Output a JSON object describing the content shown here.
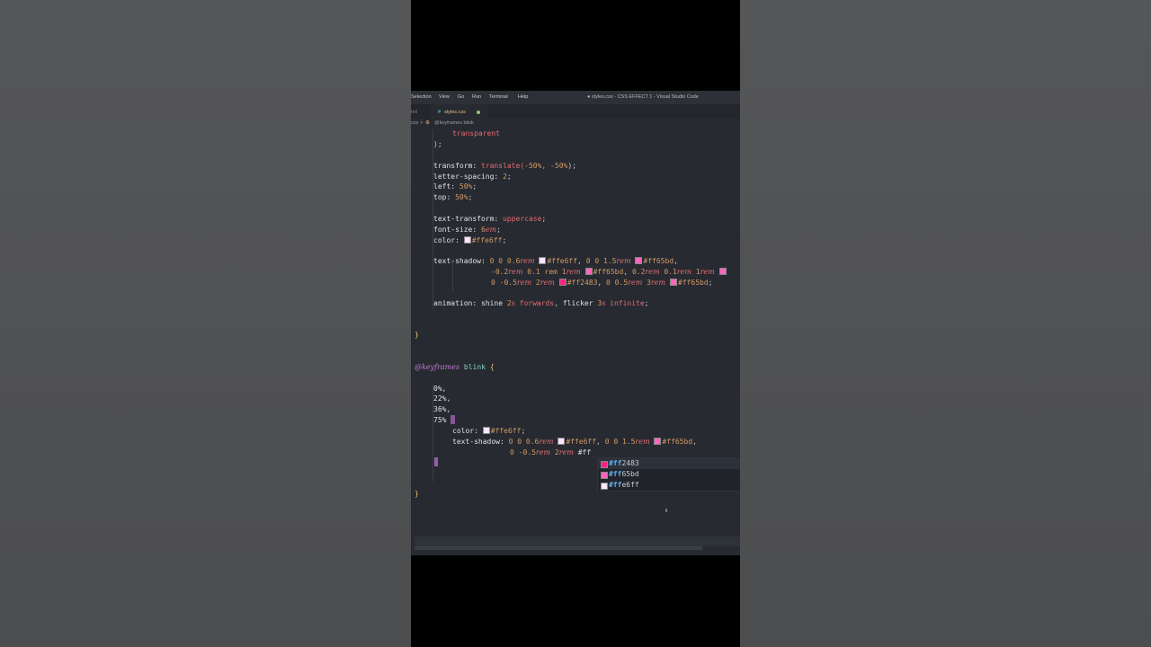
{
  "window": {
    "title": "● styles.css - CSS EFFECT 1 - Visual Studio Code",
    "menu": [
      "Selection",
      "View",
      "Go",
      "Run",
      "Terminal",
      "Help"
    ]
  },
  "tabs": {
    "previous": "tml",
    "active_icon": "#",
    "active": "styles.css"
  },
  "breadcrumb": {
    "file": "css",
    "sep": ">",
    "symbol": "@keyframes blink"
  },
  "colors": {
    "ffe6ff": "#ffe6ff",
    "ff65bd": "#ff65bd",
    "ff2483": "#ff2483",
    "accent": "#c678dd"
  },
  "code": {
    "l1": "transparent",
    "l2": ");",
    "transform_prop": "transform: ",
    "transform_val": "translate(",
    "transform_args": "-50%, -50%",
    "transform_end": ");",
    "ls_prop": "letter-spacing: ",
    "ls_val": "2",
    "left_prop": "left: ",
    "left_val": "50%",
    "top_prop": "top: ",
    "top_val": "50%",
    "tt_prop": "text-transform: ",
    "tt_val": "uppercase",
    "fs_prop": "font-size: ",
    "fs_val": "6",
    "fs_unit": "em",
    "color_prop": "color: ",
    "ffe6ff": "#ffe6ff",
    "ff65bd": "#ff65bd",
    "ff2483": "#ff2483",
    "ts_prop": "text-shadow: ",
    "ts1_a": "0 0 0.6",
    "rem": "rem",
    "ts1_b": "0 0 1.5",
    "ts2_a": "-0.2",
    "ts2_b": " 0.1 rem 1",
    "ts2_c": "0.2",
    "ts2_d": " 0.1",
    "ts2_e": " 1",
    "ts3_a": "0 -0.5",
    "ts3_b": " 2",
    "ts3_c": "0 0.5",
    "ts3_d": " 3",
    "anim_prop": "animation: ",
    "anim_a": "shine ",
    "anim_2": "2",
    "s": "s",
    "anim_fwd": "forwards",
    "anim_b": "flicker ",
    "anim_3": "3",
    "anim_inf": "infinite",
    "close": "}",
    "keyframes": "@keyframes",
    "blink": "blink",
    "open": "{",
    "k0": "0%,",
    "k22": "22%,",
    "k36": "36%,",
    "k75": "75%",
    "k_ts_b": "0 0 1.5",
    "k3_a": "0 -0.5",
    "k3_b": " 2",
    "typed": "#ff"
  },
  "suggestions": [
    {
      "match": "#ff",
      "rest": "2483"
    },
    {
      "match": "#ff",
      "rest": "65bd"
    },
    {
      "match": "#ff",
      "rest": "e6ff"
    }
  ]
}
